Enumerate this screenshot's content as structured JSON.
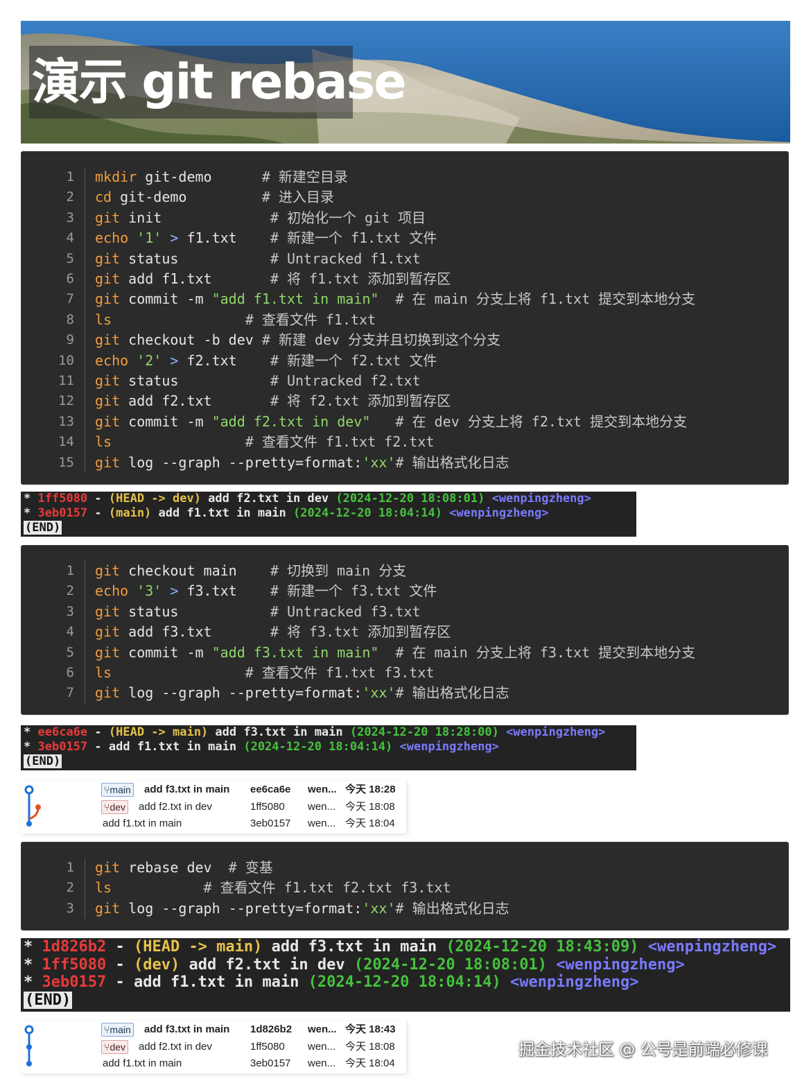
{
  "banner": {
    "title": "演示 git rebase"
  },
  "block1": {
    "lines": [
      {
        "n": "1",
        "cmd": "mkdir",
        "rest": " git-demo",
        "pad": "      ",
        "comment": "# 新建空目录"
      },
      {
        "n": "2",
        "cmd": "cd",
        "rest": " git-demo",
        "pad": "         ",
        "comment": "# 进入目录"
      },
      {
        "n": "3",
        "cmd": "git",
        "rest": " init",
        "pad": "             ",
        "comment": "# 初始化一个 git 项目"
      },
      {
        "n": "4",
        "cmd": "echo",
        "str": " '1'",
        "op": " >",
        "rest": " f1.txt",
        "pad": "    ",
        "comment": "# 新建一个 f1.txt 文件"
      },
      {
        "n": "5",
        "cmd": "git",
        "rest": " status",
        "pad": "           ",
        "comment": "# Untracked f1.txt"
      },
      {
        "n": "6",
        "cmd": "git",
        "rest": " add f1.txt",
        "pad": "       ",
        "comment": "# 将 f1.txt 添加到暂存区"
      },
      {
        "n": "7",
        "cmd": "git",
        "rest": " commit -m ",
        "str": "\"add f1.txt in main\"",
        "pad": "  ",
        "comment": "# 在 main 分支上将 f1.txt 提交到本地分支"
      },
      {
        "n": "8",
        "cmd": "ls",
        "rest": "",
        "pad": "                ",
        "comment": "# 查看文件 f1.txt"
      },
      {
        "n": "9",
        "cmd": "git",
        "rest": " checkout -b dev",
        "pad": " ",
        "comment": "# 新建 dev 分支并且切换到这个分支"
      },
      {
        "n": "10",
        "cmd": "echo",
        "str": " '2'",
        "op": " >",
        "rest": " f2.txt",
        "pad": "    ",
        "comment": "# 新建一个 f2.txt 文件"
      },
      {
        "n": "11",
        "cmd": "git",
        "rest": " status",
        "pad": "           ",
        "comment": "# Untracked f2.txt"
      },
      {
        "n": "12",
        "cmd": "git",
        "rest": " add f2.txt",
        "pad": "       ",
        "comment": "# 将 f2.txt 添加到暂存区"
      },
      {
        "n": "13",
        "cmd": "git",
        "rest": " commit -m ",
        "str": "\"add f2.txt in dev\"",
        "pad": "   ",
        "comment": "# 在 dev 分支上将 f2.txt 提交到本地分支"
      },
      {
        "n": "14",
        "cmd": "ls",
        "rest": "",
        "pad": "                ",
        "comment": "# 查看文件 f1.txt f2.txt"
      },
      {
        "n": "15",
        "cmd": "git",
        "rest": " log --graph --pretty=format:",
        "str": "'xx'",
        "pad": "",
        "comment": "# 输出格式化日志"
      }
    ]
  },
  "term1": {
    "rows": [
      {
        "star": "*",
        "hash": "1ff5080",
        "dash": " - ",
        "ref": "(HEAD -> dev)",
        "msg": " add f2.txt in dev ",
        "date": "(2024-12-20 18:08:01)",
        "author": " <wenpingzheng>"
      },
      {
        "star": "*",
        "hash": "3eb0157",
        "dash": " - ",
        "ref": "(main)",
        "msg": " add f1.txt in main ",
        "date": "(2024-12-20 18:04:14)",
        "author": " <wenpingzheng>"
      }
    ],
    "end": "(END)"
  },
  "block2": {
    "lines": [
      {
        "n": "1",
        "cmd": "git",
        "rest": " checkout main",
        "pad": "    ",
        "comment": "# 切换到 main 分支"
      },
      {
        "n": "2",
        "cmd": "echo",
        "str": " '3'",
        "op": " >",
        "rest": " f3.txt",
        "pad": "    ",
        "comment": "# 新建一个 f3.txt 文件"
      },
      {
        "n": "3",
        "cmd": "git",
        "rest": " status",
        "pad": "           ",
        "comment": "# Untracked f3.txt"
      },
      {
        "n": "4",
        "cmd": "git",
        "rest": " add f3.txt",
        "pad": "       ",
        "comment": "# 将 f3.txt 添加到暂存区"
      },
      {
        "n": "5",
        "cmd": "git",
        "rest": " commit -m ",
        "str": "\"add f3.txt in main\"",
        "pad": "  ",
        "comment": "# 在 main 分支上将 f3.txt 提交到本地分支"
      },
      {
        "n": "6",
        "cmd": "ls",
        "rest": "",
        "pad": "                ",
        "comment": "# 查看文件 f1.txt f3.txt"
      },
      {
        "n": "7",
        "cmd": "git",
        "rest": " log --graph --pretty=format:",
        "str": "'xx'",
        "pad": "",
        "comment": "# 输出格式化日志"
      }
    ]
  },
  "term2": {
    "rows": [
      {
        "star": "*",
        "hash": "ee6ca6e",
        "dash": " - ",
        "ref": "(HEAD -> main)",
        "msg": " add f3.txt in main ",
        "date": "(2024-12-20 18:28:00)",
        "author": " <wenpingzheng>"
      },
      {
        "star": "*",
        "hash": "3eb0157",
        "dash": " - ",
        "ref": "",
        "msg": "add f1.txt in main ",
        "date": "(2024-12-20 18:04:14)",
        "author": " <wenpingzheng>"
      }
    ],
    "end": "(END)"
  },
  "graph1": {
    "rows": [
      {
        "badge": "main",
        "msg": "add f3.txt in main",
        "hash": "ee6ca6e",
        "author": "wen...",
        "time": "今天 18:28",
        "bold": true
      },
      {
        "badge": "dev",
        "msg": "add f2.txt in dev",
        "hash": "1ff5080",
        "author": "wen...",
        "time": "今天 18:08",
        "bold": false
      },
      {
        "badge": "",
        "msg": "add f1.txt in main",
        "hash": "3eb0157",
        "author": "wen...",
        "time": "今天 18:04",
        "bold": false
      }
    ]
  },
  "block3": {
    "lines": [
      {
        "n": "1",
        "cmd": "git",
        "rest": " rebase dev",
        "pad": "  ",
        "comment": "# 变基"
      },
      {
        "n": "2",
        "cmd": "ls",
        "rest": "",
        "pad": "           ",
        "comment": "# 查看文件 f1.txt f2.txt f3.txt"
      },
      {
        "n": "3",
        "cmd": "git",
        "rest": " log --graph --pretty=format:",
        "str": "'xx'",
        "pad": "",
        "comment": "# 输出格式化日志"
      }
    ]
  },
  "term3": {
    "rows": [
      {
        "star": "*",
        "hash": "1d826b2",
        "dash": " - ",
        "ref": "(HEAD -> main)",
        "msg": " add f3.txt in main ",
        "date": "(2024-12-20 18:43:09)",
        "author": " <wenpingzheng>"
      },
      {
        "star": "*",
        "hash": "1ff5080",
        "dash": " - ",
        "ref": "(dev)",
        "msg": " add f2.txt in dev ",
        "date": "(2024-12-20 18:08:01)",
        "author": " <wenpingzheng>"
      },
      {
        "star": "*",
        "hash": "3eb0157",
        "dash": " - ",
        "ref": "",
        "msg": "add f1.txt in main ",
        "date": "(2024-12-20 18:04:14)",
        "author": " <wenpingzheng>"
      }
    ],
    "end": "(END)"
  },
  "graph2": {
    "rows": [
      {
        "badge": "main",
        "msg": "add f3.txt in main",
        "hash": "1d826b2",
        "author": "wen...",
        "time": "今天 18:43",
        "bold": true
      },
      {
        "badge": "dev",
        "msg": "add f2.txt in dev",
        "hash": "1ff5080",
        "author": "wen...",
        "time": "今天 18:08",
        "bold": false
      },
      {
        "badge": "",
        "msg": "add f1.txt in main",
        "hash": "3eb0157",
        "author": "wen...",
        "time": "今天 18:04",
        "bold": false
      }
    ]
  },
  "watermark": "掘金技术社区 @ 公号是前端必修课",
  "colors": {
    "code_bg": "#2b2b2b",
    "keyword": "#f39c3c",
    "string": "#90d86a",
    "hash": "#e83b3b",
    "ref": "#e6c24a",
    "date": "#46c23d",
    "author": "#7a7aff",
    "main_node": "#1e6fd9",
    "dev_node": "#e0531f"
  }
}
